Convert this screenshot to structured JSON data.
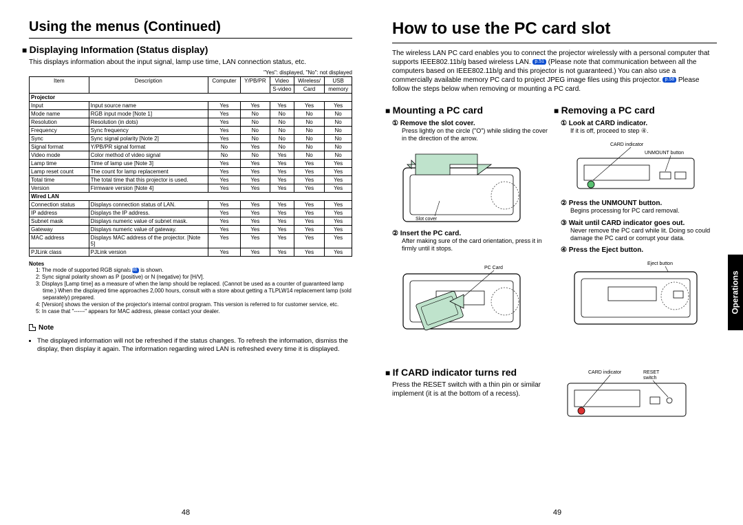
{
  "left": {
    "title": "Using the menus (Continued)",
    "section": "Displaying Information (Status display)",
    "intro": "This displays information about the input signal, lamp use time, LAN connection status, etc.",
    "caption": "\"Yes\": displayed, \"No\": not displayed",
    "headers": {
      "item": "Item",
      "desc": "Description",
      "c1": "Computer",
      "c2": "Y/PB/PR",
      "c3a": "Video",
      "c3b": "S-video",
      "c4a": "Wireless/",
      "c4b": "Card",
      "c5a": "USB",
      "c5b": "memory"
    },
    "groups": [
      {
        "label": "Projector",
        "rows": [
          {
            "item": "Input",
            "desc": "Input source name",
            "v": [
              "Yes",
              "Yes",
              "Yes",
              "Yes",
              "Yes"
            ]
          },
          {
            "item": "Mode name",
            "desc": "RGB input mode [Note 1]",
            "v": [
              "Yes",
              "No",
              "No",
              "No",
              "No"
            ]
          },
          {
            "item": "Resolution",
            "desc": "Resolution (in dots)",
            "v": [
              "Yes",
              "No",
              "No",
              "No",
              "No"
            ]
          },
          {
            "item": "Frequency",
            "desc": "Sync frequency",
            "v": [
              "Yes",
              "No",
              "No",
              "No",
              "No"
            ]
          },
          {
            "item": "Sync",
            "desc": "Sync signal polarity [Note 2]",
            "v": [
              "Yes",
              "No",
              "No",
              "No",
              "No"
            ]
          },
          {
            "item": "Signal format",
            "desc": "Y/PB/PR signal format",
            "v": [
              "No",
              "Yes",
              "No",
              "No",
              "No"
            ]
          },
          {
            "item": "Video mode",
            "desc": "Color method of video signal",
            "v": [
              "No",
              "No",
              "Yes",
              "No",
              "No"
            ]
          },
          {
            "item": "Lamp time",
            "desc": "Time of lamp use [Note 3]",
            "v": [
              "Yes",
              "Yes",
              "Yes",
              "Yes",
              "Yes"
            ]
          },
          {
            "item": "Lamp reset count",
            "desc": "The count for lamp replacement",
            "v": [
              "Yes",
              "Yes",
              "Yes",
              "Yes",
              "Yes"
            ]
          },
          {
            "item": "Total time",
            "desc": "The total time that this projector is used.",
            "v": [
              "Yes",
              "Yes",
              "Yes",
              "Yes",
              "Yes"
            ]
          },
          {
            "item": "Version",
            "desc": "Firmware version [Note 4]",
            "v": [
              "Yes",
              "Yes",
              "Yes",
              "Yes",
              "Yes"
            ]
          }
        ]
      },
      {
        "label": "Wired LAN",
        "rows": [
          {
            "item": "Connection status",
            "desc": "Displays connection status of LAN.",
            "v": [
              "Yes",
              "Yes",
              "Yes",
              "Yes",
              "Yes"
            ]
          },
          {
            "item": "IP address",
            "desc": "Displays the IP address.",
            "v": [
              "Yes",
              "Yes",
              "Yes",
              "Yes",
              "Yes"
            ]
          },
          {
            "item": "Subnet mask",
            "desc": "Displays numeric value of subnet mask.",
            "v": [
              "Yes",
              "Yes",
              "Yes",
              "Yes",
              "Yes"
            ]
          },
          {
            "item": "Gateway",
            "desc": "Displays numeric value of gateway.",
            "v": [
              "Yes",
              "Yes",
              "Yes",
              "Yes",
              "Yes"
            ]
          },
          {
            "item": "MAC address",
            "desc": "Displays MAC address of the projector. [Note 5]",
            "v": [
              "Yes",
              "Yes",
              "Yes",
              "Yes",
              "Yes"
            ]
          },
          {
            "item": "PJLink class",
            "desc": "PJLink version",
            "v": [
              "Yes",
              "Yes",
              "Yes",
              "Yes",
              "Yes"
            ]
          }
        ]
      }
    ],
    "notes_head": "Notes",
    "notes": [
      {
        "n": "1:",
        "t": "The mode of supported RGB signals ",
        "ref": "p.88",
        "t2": " is shown."
      },
      {
        "n": "2:",
        "t": "Sync signal polarity shown as P (positive) or N (negative) for [H/V]."
      },
      {
        "n": "3:",
        "t": "Displays [Lamp time] as a measure of when the lamp should be replaced. (Cannot be used as a counter of guaranteed lamp time.) When the displayed time approaches 2,000 hours, consult with a store about getting a TLPLW14 replacement lamp (sold separately) prepared."
      },
      {
        "n": "4:",
        "t": "[Version] shows the version of the projector's internal control program. This version is referred to for customer service, etc."
      },
      {
        "n": "5:",
        "t": "In case that \"------\" appears for MAC address, please contact your dealer."
      }
    ],
    "note_label": "Note",
    "note_bullet": "The displayed information will not be refreshed if the status changes. To refresh the information, dismiss the display, then display it again. The information regarding wired LAN is refreshed every time it is displayed.",
    "pagenum": "48"
  },
  "right": {
    "title": "How to use the PC card slot",
    "intro1": "The wireless LAN PC card enables you to connect the projector wirelessly with a personal computer that supports IEEE802.11b/g based wireless LAN. ",
    "ref1": "p.51",
    "intro2": " (Please note that communication between all the computers based on IEEE802.11b/g and this projector is not guaranteed.)  You can also use a commercially available memory PC card to project JPEG image files using this projector. ",
    "ref2": "p.58",
    "intro3": " Please follow the steps below when removing or mounting a PC card.",
    "mount_h": "Mounting a PC card",
    "mount1_h": "①  Remove the slot cover.",
    "mount1_b": "Press lightly on the circle (\"O\") while sliding the cover in the direction of the arrow.",
    "fig1_label": "Slot cover",
    "mount2_h": "②  Insert the PC card.",
    "mount2_b": "After making sure of the card orientation, press it in firmly until it stops.",
    "fig2_label": "PC Card",
    "remove_h": "Removing a PC card",
    "rem1_h": "①  Look at CARD indicator.",
    "rem1_b": "If it is off, proceed to step ④.",
    "fig3_l1": "CARD indicator",
    "fig3_l2": "UNMOUNT button",
    "rem2_h": "②  Press the UNMOUNT button.",
    "rem2_b": "Begins processing for PC card removal.",
    "rem3_h": "③  Wait until CARD indicator goes out.",
    "rem3_b": "Never remove the PC card while lit. Doing so could damage the PC card or corrupt your data.",
    "rem4_h": "④  Press the Eject button.",
    "fig4_l": "Eject button",
    "if_h": "If CARD indicator turns red",
    "if_b": "Press the RESET switch with a thin pin or similar implement (it is at the bottom of a recess).",
    "fig5_l1": "CARD indicator",
    "fig5_l2": "RESET switch",
    "tab": "Operations",
    "pagenum": "49"
  }
}
